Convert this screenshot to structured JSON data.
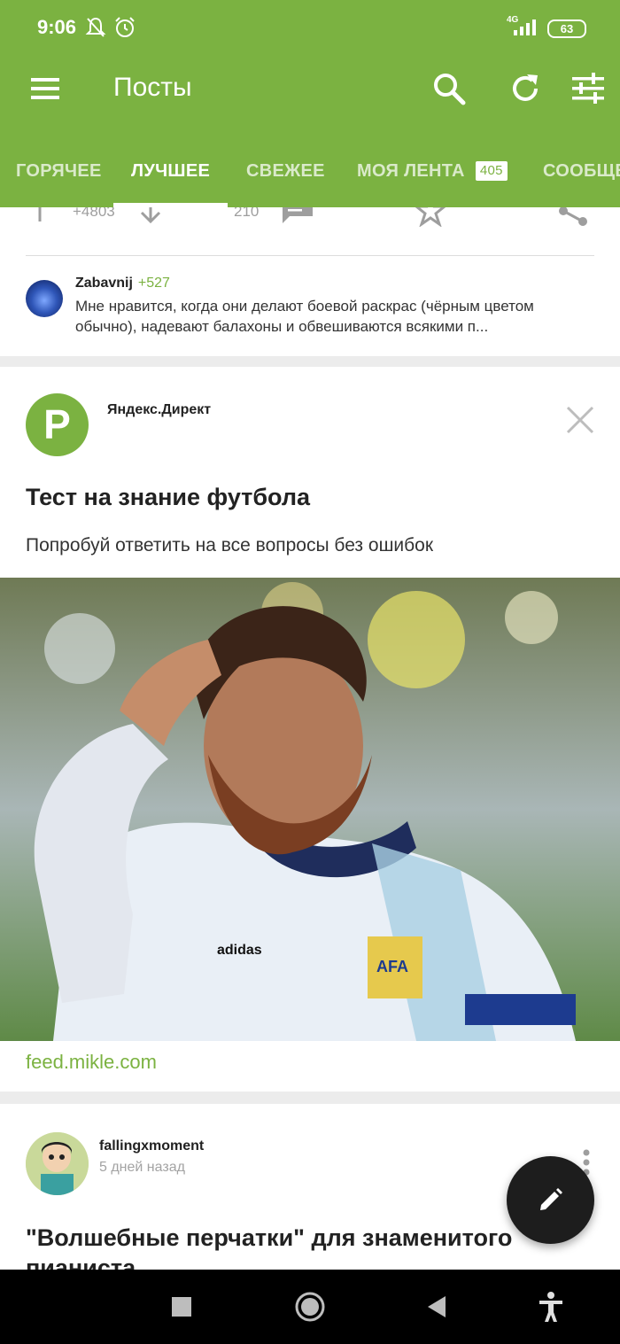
{
  "status_bar": {
    "time": "9:06",
    "network": "4G",
    "battery": "63"
  },
  "toolbar": {
    "title": "Посты",
    "menu_icon": "menu-icon",
    "search_icon": "search-icon",
    "refresh_icon": "refresh-icon",
    "filter_icon": "tune-icon"
  },
  "tabs": [
    {
      "label": "ГОРЯЧЕЕ"
    },
    {
      "label": "ЛУЧШЕЕ",
      "active": true
    },
    {
      "label": "СВЕЖЕЕ"
    },
    {
      "label": "МОЯ ЛЕНТА",
      "badge": "405"
    },
    {
      "label": "СООБЩЕСТВА"
    }
  ],
  "post_actions": {
    "rating": "+4803",
    "comments": "210"
  },
  "top_comment": {
    "author": "Zabavnij",
    "rating": "+527",
    "text": "Мне нравится, когда они делают боевой раскрас (чёрным цветом обычно), надевают балахоны и обвешиваются всякими п..."
  },
  "ad": {
    "logo_letter": "P",
    "source": "Яндекс.Директ",
    "title": "Тест на знание футбола",
    "description": "Попробуй ответить на все вопросы без ошибок",
    "link": "feed.mikle.com"
  },
  "post": {
    "author": "fallingxmoment",
    "time": "5 дней назад",
    "title": "\"Волшебные перчатки\" для знаменитого пианиста"
  },
  "colors": {
    "accent": "#7bb241",
    "fab": "#1d1d1d",
    "navbar": "#000000"
  }
}
